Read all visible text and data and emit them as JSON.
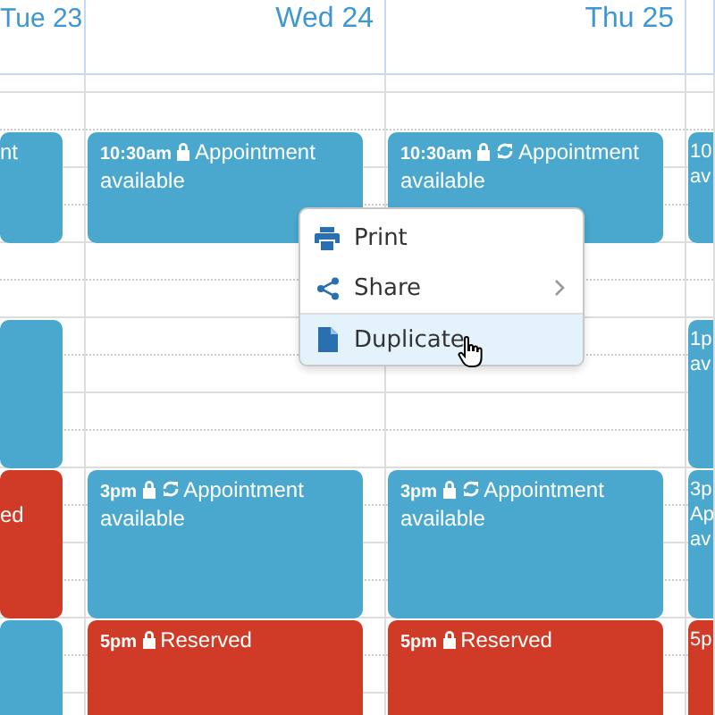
{
  "calendar": {
    "columns": [
      {
        "header": "Tue 23",
        "events": [
          {
            "kind": "clipped",
            "color": "#4aa8cf",
            "lines": [
              "nt"
            ]
          },
          {
            "kind": "clipped",
            "color": "#4aa8cf"
          },
          {
            "kind": "clipped",
            "color": "#cf3b27",
            "lines": [
              "ed"
            ]
          },
          {
            "kind": "clipped",
            "color": "#4aa8cf"
          }
        ]
      },
      {
        "header": "Wed 24",
        "events": [
          {
            "kind": "full",
            "color": "#4aa8cf",
            "time": "10:30am",
            "locked": true,
            "recurring": false,
            "title": "Appointment available"
          },
          {
            "kind": "full",
            "color": "#4aa8cf",
            "time": "3pm",
            "locked": true,
            "recurring": true,
            "title": "Appointment available"
          },
          {
            "kind": "full",
            "color": "#cf3b27",
            "time": "5pm",
            "locked": true,
            "recurring": false,
            "title": "Reserved"
          }
        ]
      },
      {
        "header": "Thu 25",
        "events": [
          {
            "kind": "full",
            "color": "#4aa8cf",
            "time": "10:30am",
            "locked": true,
            "recurring": true,
            "title": "Appointment available"
          },
          {
            "kind": "full",
            "color": "#4aa8cf",
            "time": "3pm",
            "locked": true,
            "recurring": true,
            "title": "Appointment available"
          },
          {
            "kind": "full",
            "color": "#cf3b27",
            "time": "5pm",
            "locked": true,
            "recurring": false,
            "title": "Reserved"
          }
        ]
      },
      {
        "events": [
          {
            "kind": "clipped",
            "color": "#4aa8cf",
            "lines": [
              "10",
              "av"
            ]
          },
          {
            "kind": "clipped",
            "color": "#4aa8cf",
            "lines": [
              "1p",
              "av"
            ]
          },
          {
            "kind": "clipped",
            "color": "#4aa8cf",
            "lines": [
              "3p",
              "Ap",
              "av"
            ]
          },
          {
            "kind": "clipped",
            "color": "#cf3b27",
            "lines": [
              "5p"
            ]
          }
        ]
      }
    ]
  },
  "context_menu": {
    "items": [
      {
        "label": "Print",
        "submenu": false,
        "highlighted": false
      },
      {
        "label": "Share",
        "submenu": true,
        "highlighted": false
      },
      {
        "label": "Duplicate",
        "submenu": false,
        "highlighted": true
      }
    ]
  }
}
